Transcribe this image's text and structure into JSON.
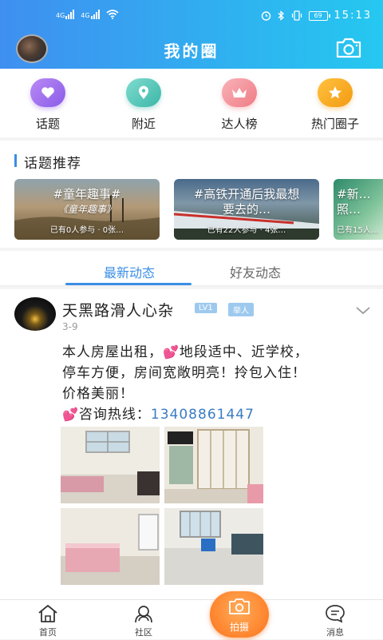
{
  "status_bar": {
    "sim1_label": "4G",
    "sim2_label": "4G",
    "battery": "69",
    "time": "15:13"
  },
  "header": {
    "title": "我的圈"
  },
  "quick_menu": [
    {
      "label": "话题",
      "icon": "heart-icon",
      "color": "#a06ef0"
    },
    {
      "label": "附近",
      "icon": "location-pin-icon",
      "color": "#4fc6b8"
    },
    {
      "label": "达人榜",
      "icon": "crown-icon",
      "color": "#f28c93"
    },
    {
      "label": "热门圈子",
      "icon": "star-icon",
      "color": "#f5a623"
    }
  ],
  "topics": {
    "title": "话题推荐",
    "cards": [
      {
        "title": "#童年趣事#",
        "subtitle": "《童年趣事》",
        "meta": "已有0人参与 · 0张…"
      },
      {
        "title": "#高铁开通后我最想要去的…",
        "meta": "已有22人参与 · 4张…"
      },
      {
        "title": "#新…照…",
        "meta": "已有15人…"
      }
    ]
  },
  "feed_tabs": [
    {
      "label": "最新动态",
      "active": true
    },
    {
      "label": "好友动态",
      "active": false
    }
  ],
  "post": {
    "author": "天黑路滑人心杂",
    "level_badge": "LV1",
    "role_badge": "举人",
    "date": "3-9",
    "text_line1": "本人房屋出租，",
    "text_line1b": "地段适中、近学校，",
    "text_line2": "停车方便，房间宽敞明亮！拎包入住！",
    "text_line3": "价格美丽！",
    "text_line4": "咨询热线：",
    "phone": "13408861447"
  },
  "bottom_nav": [
    {
      "label": "首页",
      "icon": "home-icon"
    },
    {
      "label": "社区",
      "icon": "community-icon"
    },
    {
      "label": "拍摄",
      "icon": "camera-icon"
    },
    {
      "label": "消息",
      "icon": "message-icon"
    }
  ],
  "colors": {
    "header_start": "#3f8ff0",
    "header_end": "#25c8f0",
    "accent": "#3a8ee6",
    "shoot_button": "#ff8a33"
  }
}
